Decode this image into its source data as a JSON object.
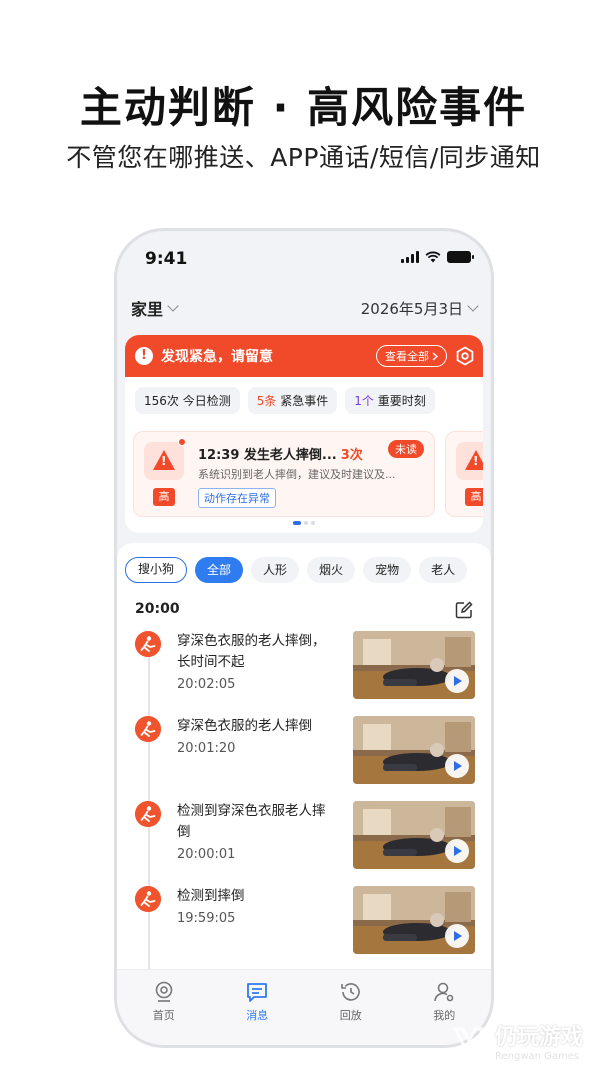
{
  "promo": {
    "headline": "主动判断 · 高风险事件",
    "subline": "不管您在哪推送、APP通话/短信/同步通知"
  },
  "status_bar": {
    "time": "9:41"
  },
  "header": {
    "location": "家里",
    "date": "2026年5月3日"
  },
  "alert": {
    "title": "发现紧急，请留意",
    "view_all": "查看全部",
    "stats": {
      "detections": "156次 今日检测",
      "urgent_count": "5条",
      "urgent_label": "紧急事件",
      "important_count": "1个",
      "important_label": "重要时刻"
    },
    "event": {
      "time_title": "12:39  发生老人摔倒...",
      "count": "3次",
      "unread": "未读",
      "description": "系统识别到老人摔倒，建议及时建议及...",
      "tag": "动作存在异常",
      "level": "高"
    },
    "event2_level": "高",
    "pager": {
      "pages": 3,
      "current": 0
    }
  },
  "filters": [
    "搜小狗",
    "全部",
    "人形",
    "烟火",
    "宠物",
    "老人"
  ],
  "active_filter": "全部",
  "timeline": {
    "group_time": "20:00",
    "items": [
      {
        "title": "穿深色衣服的老人摔倒，长时间不起",
        "time": "20:02:05"
      },
      {
        "title": "穿深色衣服的老人摔倒",
        "time": "20:01:20"
      },
      {
        "title": "检测到穿深色衣服老人摔倒",
        "time": "20:00:01"
      },
      {
        "title": "检测到摔倒",
        "time": "19:59:05"
      }
    ]
  },
  "tabbar": {
    "home": "首页",
    "messages": "消息",
    "playback": "回放",
    "mine": "我的"
  },
  "watermark": {
    "text": "仍玩游戏",
    "sub": "Rengwan Games"
  },
  "colors": {
    "accent": "#2f7bf0",
    "alert": "#f04a2a"
  }
}
